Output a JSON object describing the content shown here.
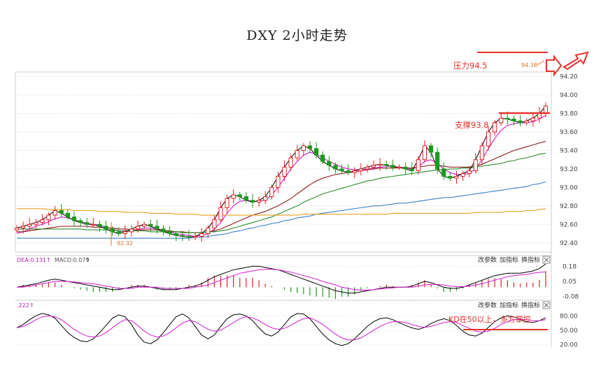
{
  "chart_data": {
    "type": "candlestick",
    "title": "DXY 2小时走势",
    "price_axis": {
      "ticks": [
        "94.20",
        "94.00",
        "93.80",
        "93.60",
        "93.40",
        "93.20",
        "93.00",
        "92.80",
        "92.60",
        "92.40"
      ],
      "ylim": [
        92.3,
        94.25
      ],
      "grid": true
    },
    "annotations": {
      "resistance_label": "压力94.5",
      "resistance_value": 94.5,
      "support_label": "支撑93.8",
      "support_value": 93.8,
      "high_marker": "94.38",
      "low_marker": "92.32",
      "kd_note": "KD在50以上，多方掌控"
    },
    "series": [
      {
        "name": "price",
        "color": "#000000",
        "values": [
          92.56,
          92.58,
          92.6,
          92.62,
          92.65,
          92.7,
          92.75,
          92.72,
          92.68,
          92.64,
          92.62,
          92.6,
          92.6,
          92.58,
          92.55,
          92.52,
          92.5,
          92.52,
          92.55,
          92.58,
          92.6,
          92.58,
          92.55,
          92.52,
          92.5,
          92.48,
          92.47,
          92.46,
          92.47,
          92.5,
          92.56,
          92.65,
          92.78,
          92.88,
          92.92,
          92.9,
          92.86,
          92.84,
          92.86,
          92.9,
          93.0,
          93.12,
          93.22,
          93.32,
          93.4,
          93.45,
          93.42,
          93.35,
          93.28,
          93.24,
          93.2,
          93.18,
          93.16,
          93.18,
          93.2,
          93.22,
          93.24,
          93.25,
          93.24,
          93.22,
          93.22,
          93.2,
          93.18,
          93.3,
          93.45,
          93.38,
          93.2,
          93.12,
          93.1,
          93.12,
          93.15,
          93.18,
          93.3,
          93.45,
          93.6,
          93.7,
          93.75,
          93.74,
          93.72,
          93.7,
          93.72,
          93.75,
          93.8,
          93.88
        ]
      },
      {
        "name": "ma-fast",
        "color": "#d11ad1",
        "values": [
          92.5,
          92.52,
          92.55,
          92.58,
          92.6,
          92.63,
          92.66,
          92.68,
          92.67,
          92.65,
          92.63,
          92.61,
          92.6,
          92.59,
          92.57,
          92.55,
          92.53,
          92.52,
          92.53,
          92.54,
          92.56,
          92.56,
          92.55,
          92.54,
          92.52,
          92.5,
          92.49,
          92.48,
          92.47,
          92.48,
          92.5,
          92.55,
          92.62,
          92.72,
          92.8,
          92.85,
          92.86,
          92.85,
          92.85,
          92.86,
          92.92,
          93.0,
          93.1,
          93.2,
          93.28,
          93.35,
          93.38,
          93.36,
          93.32,
          93.28,
          93.25,
          93.22,
          93.2,
          93.19,
          93.19,
          93.2,
          93.21,
          93.22,
          93.23,
          93.23,
          93.22,
          93.21,
          93.2,
          93.22,
          93.28,
          93.3,
          93.26,
          93.2,
          93.16,
          93.14,
          93.14,
          93.15,
          93.2,
          93.3,
          93.42,
          93.53,
          93.62,
          93.67,
          93.69,
          93.7,
          93.7,
          93.71,
          93.74,
          93.78
        ]
      },
      {
        "name": "ma-slow",
        "color": "#8b1a1a",
        "values": [
          92.52,
          92.52,
          92.53,
          92.54,
          92.55,
          92.56,
          92.57,
          92.58,
          92.58,
          92.58,
          92.58,
          92.58,
          92.57,
          92.57,
          92.56,
          92.56,
          92.55,
          92.55,
          92.54,
          92.54,
          92.54,
          92.54,
          92.54,
          92.53,
          92.53,
          92.52,
          92.52,
          92.51,
          92.51,
          92.51,
          92.52,
          92.53,
          92.55,
          92.58,
          92.61,
          92.64,
          92.67,
          92.7,
          92.72,
          92.74,
          92.77,
          92.8,
          92.84,
          92.88,
          92.93,
          92.98,
          93.03,
          93.07,
          93.1,
          93.12,
          93.14,
          93.15,
          93.16,
          93.17,
          93.18,
          93.19,
          93.2,
          93.21,
          93.21,
          93.21,
          93.21,
          93.21,
          93.21,
          93.22,
          93.23,
          93.24,
          93.24,
          93.23,
          93.22,
          93.22,
          93.22,
          93.22,
          93.23,
          93.25,
          93.28,
          93.31,
          93.34,
          93.37,
          93.4,
          93.42,
          93.44,
          93.46,
          93.48,
          93.5
        ]
      },
      {
        "name": "ma-green",
        "color": "#2e8b2e",
        "values": [
          92.55,
          92.55,
          92.55,
          92.55,
          92.55,
          92.55,
          92.55,
          92.55,
          92.55,
          92.55,
          92.55,
          92.54,
          92.54,
          92.54,
          92.54,
          92.54,
          92.53,
          92.53,
          92.53,
          92.53,
          92.53,
          92.52,
          92.52,
          92.52,
          92.52,
          92.52,
          92.51,
          92.51,
          92.51,
          92.51,
          92.52,
          92.52,
          92.53,
          92.54,
          92.56,
          92.58,
          92.6,
          92.62,
          92.64,
          92.66,
          92.68,
          92.71,
          92.74,
          92.77,
          92.8,
          92.84,
          92.87,
          92.9,
          92.93,
          92.95,
          92.97,
          92.99,
          93.01,
          93.03,
          93.05,
          93.07,
          93.08,
          93.1,
          93.11,
          93.12,
          93.13,
          93.14,
          93.15,
          93.16,
          93.17,
          93.18,
          93.19,
          93.19,
          93.2,
          93.2,
          93.21,
          93.21,
          93.22,
          93.23,
          93.24,
          93.25,
          93.26,
          93.28,
          93.29,
          93.31,
          93.32,
          93.34,
          93.36,
          93.37
        ]
      },
      {
        "name": "ma-blue",
        "color": "#3a80c8",
        "values": [
          92.45,
          92.45,
          92.45,
          92.45,
          92.45,
          92.45,
          92.45,
          92.45,
          92.45,
          92.45,
          92.45,
          92.45,
          92.45,
          92.45,
          92.45,
          92.45,
          92.45,
          92.45,
          92.45,
          92.45,
          92.45,
          92.45,
          92.45,
          92.45,
          92.45,
          92.45,
          92.45,
          92.45,
          92.46,
          92.46,
          92.47,
          92.48,
          92.49,
          92.5,
          92.52,
          92.53,
          92.55,
          92.56,
          92.58,
          92.59,
          92.61,
          92.62,
          92.64,
          92.65,
          92.67,
          92.68,
          92.69,
          92.71,
          92.72,
          92.73,
          92.74,
          92.75,
          92.76,
          92.77,
          92.78,
          92.79,
          92.8,
          92.8,
          92.81,
          92.82,
          92.83,
          92.83,
          92.84,
          92.85,
          92.86,
          92.87,
          92.88,
          92.89,
          92.89,
          92.9,
          92.91,
          92.92,
          92.93,
          92.94,
          92.95,
          92.96,
          92.97,
          92.98,
          92.99,
          93.0,
          93.01,
          93.03,
          93.04,
          93.06
        ]
      },
      {
        "name": "ma-orange",
        "color": "#e8a020",
        "values": [
          92.77,
          92.77,
          92.77,
          92.77,
          92.77,
          92.76,
          92.76,
          92.76,
          92.76,
          92.75,
          92.75,
          92.75,
          92.75,
          92.74,
          92.74,
          92.74,
          92.74,
          92.73,
          92.73,
          92.73,
          92.73,
          92.72,
          92.72,
          92.72,
          92.72,
          92.71,
          92.71,
          92.71,
          92.71,
          92.7,
          92.7,
          92.7,
          92.7,
          92.7,
          92.7,
          92.7,
          92.7,
          92.7,
          92.7,
          92.7,
          92.7,
          92.7,
          92.7,
          92.7,
          92.7,
          92.71,
          92.71,
          92.71,
          92.71,
          92.71,
          92.71,
          92.71,
          92.71,
          92.71,
          92.71,
          92.71,
          92.71,
          92.71,
          92.71,
          92.72,
          92.72,
          92.72,
          92.72,
          92.72,
          92.72,
          92.72,
          92.72,
          92.72,
          92.72,
          92.72,
          92.72,
          92.72,
          92.73,
          92.73,
          92.73,
          92.73,
          92.73,
          92.74,
          92.74,
          92.74,
          92.75,
          92.75,
          92.76,
          92.77
        ]
      }
    ],
    "macd": {
      "label_dea": "DEA:0.131",
      "label_macd": "MACD:0.079",
      "buttons": [
        "改参数",
        "加指标",
        "换指标"
      ],
      "ticks": [
        "0.18",
        "0.05",
        "-0.08"
      ],
      "ylim": [
        -0.1,
        0.2
      ],
      "dif": [
        0.0,
        0.01,
        0.02,
        0.03,
        0.045,
        0.06,
        0.07,
        0.06,
        0.05,
        0.04,
        0.03,
        0.02,
        0.01,
        0.0,
        -0.01,
        -0.02,
        -0.02,
        -0.01,
        0.0,
        0.01,
        0.01,
        0.0,
        -0.01,
        -0.02,
        -0.02,
        -0.02,
        -0.01,
        0.0,
        0.01,
        0.03,
        0.06,
        0.09,
        0.11,
        0.13,
        0.15,
        0.16,
        0.17,
        0.18,
        0.18,
        0.17,
        0.16,
        0.15,
        0.13,
        0.11,
        0.09,
        0.07,
        0.05,
        0.03,
        0.01,
        -0.01,
        -0.03,
        -0.04,
        -0.05,
        -0.05,
        -0.04,
        -0.03,
        -0.02,
        -0.01,
        0.0,
        0.0,
        0.0,
        0.0,
        0.01,
        0.03,
        0.05,
        0.04,
        0.02,
        0.0,
        -0.01,
        -0.01,
        0.0,
        0.02,
        0.04,
        0.06,
        0.08,
        0.1,
        0.11,
        0.12,
        0.12,
        0.12,
        0.13,
        0.14,
        0.16,
        0.2
      ],
      "dea": [
        0.0,
        0.0,
        0.01,
        0.02,
        0.03,
        0.04,
        0.05,
        0.05,
        0.05,
        0.045,
        0.04,
        0.035,
        0.03,
        0.02,
        0.01,
        0.0,
        -0.01,
        -0.01,
        -0.01,
        0.0,
        0.0,
        0.0,
        0.0,
        -0.01,
        -0.01,
        -0.01,
        -0.01,
        -0.01,
        0.0,
        0.01,
        0.02,
        0.04,
        0.06,
        0.08,
        0.1,
        0.12,
        0.13,
        0.14,
        0.15,
        0.155,
        0.155,
        0.15,
        0.14,
        0.13,
        0.115,
        0.1,
        0.085,
        0.07,
        0.05,
        0.035,
        0.02,
        0.0,
        -0.01,
        -0.02,
        -0.025,
        -0.025,
        -0.02,
        -0.015,
        -0.01,
        -0.005,
        0.0,
        0.0,
        0.0,
        0.01,
        0.02,
        0.025,
        0.025,
        0.02,
        0.01,
        0.005,
        0.005,
        0.01,
        0.02,
        0.03,
        0.045,
        0.06,
        0.075,
        0.09,
        0.1,
        0.105,
        0.11,
        0.12,
        0.128,
        0.131
      ]
    },
    "kd": {
      "label": ".222",
      "buttons": [
        "改参数",
        "加指标",
        "换指标"
      ],
      "ticks": [
        "80.00",
        "50.00",
        "20.00"
      ],
      "ylim": [
        15,
        95
      ],
      "k": [
        55,
        62,
        72,
        80,
        85,
        82,
        75,
        60,
        45,
        35,
        28,
        26,
        32,
        45,
        60,
        75,
        82,
        78,
        62,
        40,
        25,
        22,
        30,
        45,
        62,
        78,
        84,
        76,
        58,
        40,
        32,
        40,
        58,
        74,
        82,
        84,
        80,
        70,
        55,
        42,
        38,
        46,
        62,
        78,
        85,
        84,
        74,
        58,
        42,
        30,
        22,
        18,
        22,
        32,
        45,
        58,
        68,
        74,
        76,
        72,
        66,
        60,
        55,
        52,
        56,
        64,
        70,
        74,
        70,
        60,
        48,
        40,
        38,
        44,
        56,
        68,
        76,
        80,
        78,
        72,
        68,
        66,
        70,
        76
      ],
      "d": [
        55,
        58,
        64,
        72,
        78,
        80,
        78,
        72,
        62,
        52,
        44,
        38,
        36,
        38,
        45,
        55,
        65,
        72,
        70,
        60,
        48,
        40,
        36,
        38,
        45,
        55,
        65,
        70,
        68,
        60,
        52,
        48,
        50,
        58,
        66,
        74,
        78,
        76,
        70,
        62,
        55,
        52,
        54,
        60,
        68,
        74,
        76,
        70,
        62,
        52,
        42,
        34,
        30,
        30,
        34,
        42,
        50,
        58,
        64,
        68,
        68,
        66,
        62,
        58,
        56,
        58,
        62,
        66,
        68,
        66,
        60,
        54,
        48,
        46,
        48,
        54,
        62,
        68,
        72,
        73,
        72,
        70,
        70,
        72
      ]
    }
  }
}
